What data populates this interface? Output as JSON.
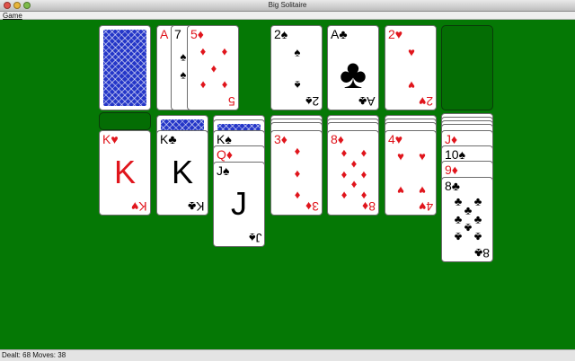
{
  "window": {
    "title": "Big Solitaire"
  },
  "menu": {
    "game": "Game"
  },
  "status": {
    "text": "Dealt: 68 Moves: 38"
  },
  "colors": {
    "table": "#057805",
    "red_suit": "#e0151c",
    "card_back": "#2436c8"
  },
  "stock": {
    "label": "card-back"
  },
  "waste": [
    {
      "rank": "A",
      "suit": "♥"
    },
    {
      "rank": "7",
      "suit": "♠"
    },
    {
      "rank": "5",
      "suit": "♦"
    }
  ],
  "foundations": [
    {
      "rank": "2",
      "suit": "♠"
    },
    {
      "rank": "A",
      "suit": "♣"
    },
    {
      "rank": "2",
      "suit": "♥"
    }
  ],
  "tableau": {
    "t1": {
      "rank": "K",
      "suit": "♥"
    },
    "t2": {
      "rank": "K",
      "suit": "♣"
    },
    "t3": [
      {
        "rank": "K",
        "suit": "♠"
      },
      {
        "rank": "Q",
        "suit": "♦"
      },
      {
        "rank": "J",
        "suit": "♠"
      }
    ],
    "t4": {
      "rank": "3",
      "suit": "♦"
    },
    "t5": {
      "rank": "8",
      "suit": "♦"
    },
    "t6": {
      "rank": "4",
      "suit": "♥"
    },
    "t7": [
      {
        "rank": "J",
        "suit": "♦"
      },
      {
        "rank": "10",
        "suit": "♠"
      },
      {
        "rank": "9",
        "suit": "♦"
      },
      {
        "rank": "8",
        "suit": "♣"
      }
    ]
  }
}
